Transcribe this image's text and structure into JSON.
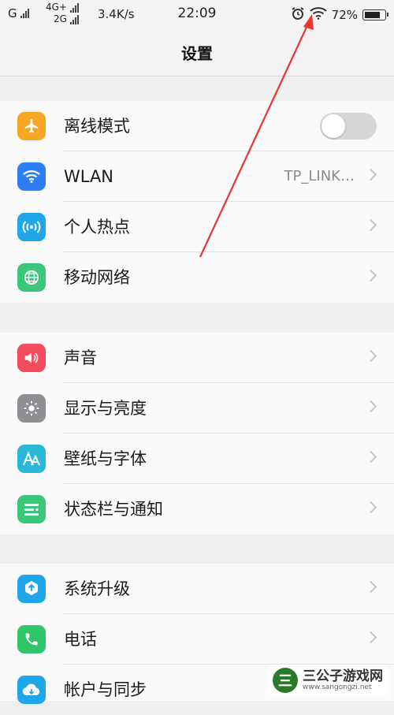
{
  "status_bar": {
    "carrier1": "G",
    "net_top": "4G+",
    "net_bottom": "2G",
    "speed": "3.4K/s",
    "time": "22:09",
    "battery": "72%",
    "icons": [
      "alarm-icon",
      "wifi-icon",
      "battery-icon"
    ]
  },
  "header": {
    "title": "设置"
  },
  "groups": [
    {
      "items": [
        {
          "label": "离线模式",
          "icon": "airplane-icon",
          "color": "#f5a623",
          "control": "toggle",
          "toggle_on": false
        },
        {
          "label": "WLAN",
          "icon": "wifi-icon",
          "color": "#2d7ff3",
          "value": "TP_LINK…"
        },
        {
          "label": "个人热点",
          "icon": "hotspot-icon",
          "color": "#1ea6e8"
        },
        {
          "label": "移动网络",
          "icon": "globe-icon",
          "color": "#3cc67a"
        }
      ]
    },
    {
      "items": [
        {
          "label": "声音",
          "icon": "speaker-icon",
          "color": "#f24c5e"
        },
        {
          "label": "显示与亮度",
          "icon": "brightness-icon",
          "color": "#8e8e93"
        },
        {
          "label": "壁纸与字体",
          "icon": "font-icon",
          "color": "#2ab8d8"
        },
        {
          "label": "状态栏与通知",
          "icon": "notification-icon",
          "color": "#3cc67a"
        }
      ]
    },
    {
      "items": [
        {
          "label": "系统升级",
          "icon": "upgrade-icon",
          "color": "#1ea6e8"
        },
        {
          "label": "电话",
          "icon": "phone-icon",
          "color": "#2fc56b"
        },
        {
          "label": "帐户与同步",
          "icon": "cloud-icon",
          "color": "#1ea6e8"
        }
      ]
    }
  ],
  "annotation": {
    "color": "#e8362c"
  },
  "watermark": {
    "logo_char": "三",
    "name": "三公子游戏网",
    "url": "www.sangongzi.net"
  }
}
